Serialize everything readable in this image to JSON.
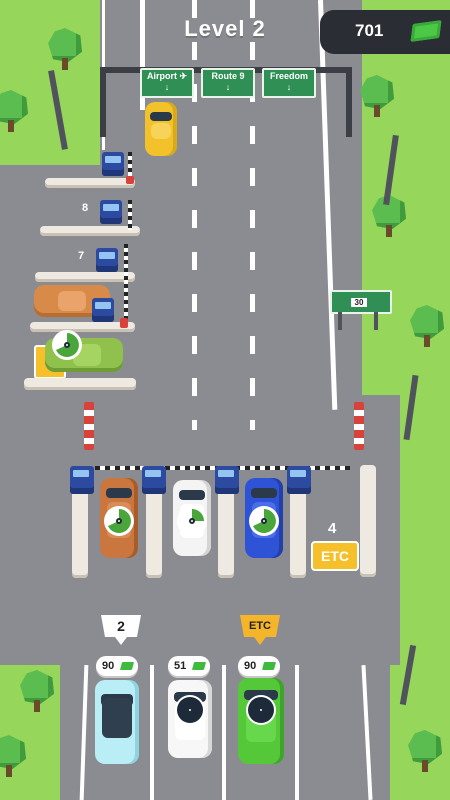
{
  "hud": {
    "level_title": "Level 2",
    "money": "701",
    "money_icon": "cash-stack-icon"
  },
  "overhead_signs": [
    {
      "label": "Airport ✈",
      "arrow": "↓"
    },
    {
      "label": "Route 9",
      "arrow": "↓"
    },
    {
      "label": "Freedom",
      "arrow": "↓"
    }
  ],
  "roadside_sign": {
    "label": "30"
  },
  "left_lane_numbers": [
    "8",
    "7"
  ],
  "toll_plaza": {
    "lane_count_label": "4",
    "etc_label": "ETC"
  },
  "queue": [
    {
      "flag": "2",
      "price": "90",
      "car_color": "#b9eef7"
    },
    {
      "flag": "",
      "price": "51",
      "car_color": "#ffffff"
    },
    {
      "flag": "ETC",
      "price": "90",
      "car_color": "#55c83a"
    }
  ],
  "colors": {
    "road": "#8b8c92",
    "grass": "#96d65a",
    "booth": "#2b4aa0",
    "etc_yellow": "#f5c02a",
    "timer_fill": "#4aa63a"
  }
}
